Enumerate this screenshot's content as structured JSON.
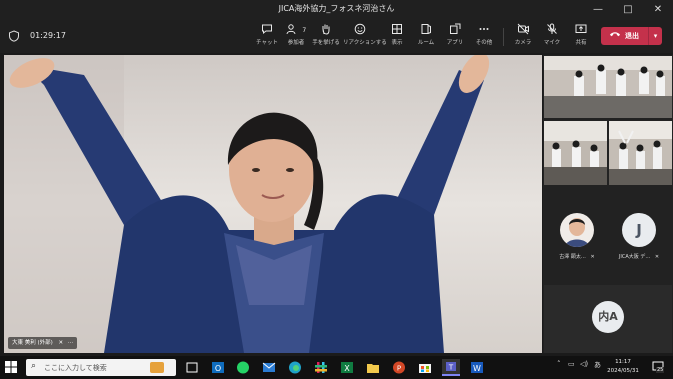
{
  "window": {
    "title": "JICA海外協力_フォスネ河治さん",
    "minimize": "—",
    "maximize": "□",
    "close": "✕"
  },
  "toolbar": {
    "elapsed": "01:29:17",
    "buttons": [
      {
        "label": "チャット",
        "icon": "chat-icon"
      },
      {
        "label": "参加者",
        "icon": "people-icon",
        "count": "7"
      },
      {
        "label": "手を挙げる",
        "icon": "raise-hand-icon"
      },
      {
        "label": "リアクションする",
        "icon": "reaction-icon"
      },
      {
        "label": "表示",
        "icon": "view-icon"
      },
      {
        "label": "ルーム",
        "icon": "rooms-icon"
      },
      {
        "label": "アプリ",
        "icon": "apps-icon"
      },
      {
        "label": "その他",
        "icon": "more-icon"
      },
      {
        "label": "カメラ",
        "icon": "camera-off-icon"
      },
      {
        "label": "マイク",
        "icon": "mic-off-icon"
      },
      {
        "label": "共有",
        "icon": "share-icon"
      }
    ],
    "leave": "退出"
  },
  "main_video": {
    "name": "大東 美利 (外部)"
  },
  "participants": [
    {
      "name": "古澤 顕太…",
      "initials": ""
    },
    {
      "name": "JICA大阪 デ…",
      "initials": "J"
    }
  ],
  "big_tile": {
    "initials": "内A"
  },
  "taskbar": {
    "search_placeholder": "ここに入力して検索",
    "time": "11:17",
    "date": "2024/05/31",
    "notifications": "25"
  },
  "colors": {
    "leave_red": "#c4314b",
    "toolbar_bg": "#1f1f1f",
    "taskbar_bg": "#111111"
  }
}
